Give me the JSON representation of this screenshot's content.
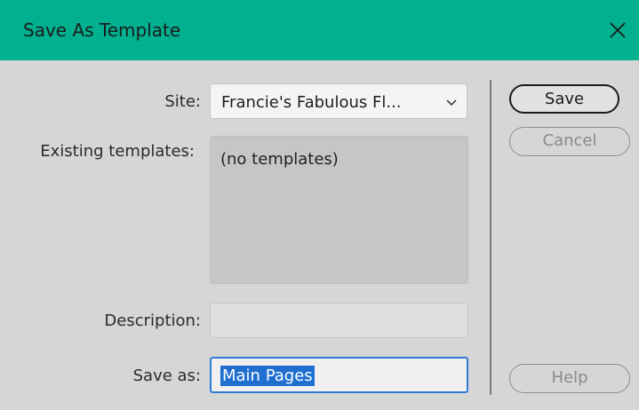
{
  "window": {
    "title": "Save As Template",
    "close_icon": "close-icon"
  },
  "form": {
    "site_label": "Site:",
    "site_value": "Francie's Fabulous Fl...",
    "existing_label": "Existing templates:",
    "existing_empty": "(no templates)",
    "description_label": "Description:",
    "description_value": "",
    "saveas_label": "Save as:",
    "saveas_value": "Main Pages"
  },
  "buttons": {
    "save": "Save",
    "cancel": "Cancel",
    "help": "Help"
  },
  "colors": {
    "titlebar": "#00b08f",
    "dialog_bg": "#d6d6d6",
    "selection": "#1f6fd1",
    "focus_border": "#2e7bd6"
  }
}
